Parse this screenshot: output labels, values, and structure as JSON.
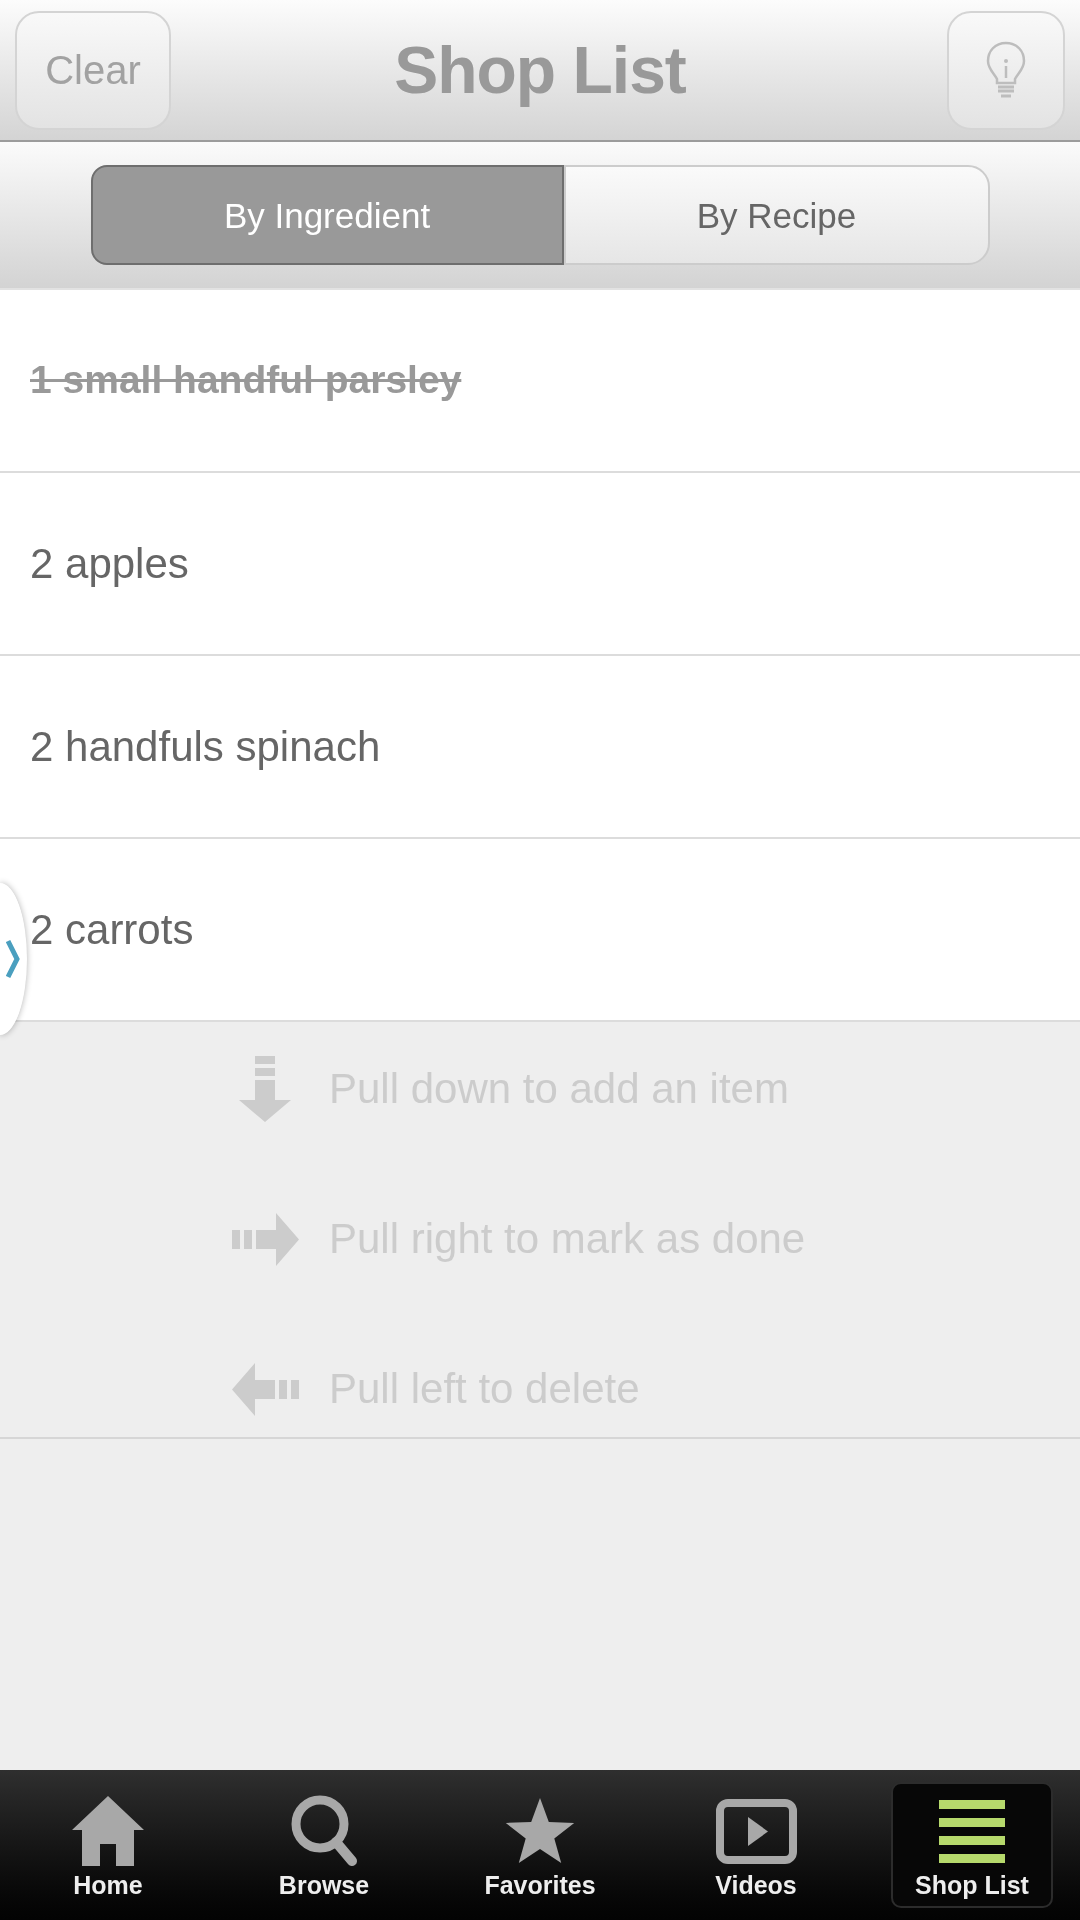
{
  "header": {
    "clear_button": "Clear",
    "title": "Shop List"
  },
  "view_tabs": [
    {
      "label": "By Ingredient",
      "selected": true
    },
    {
      "label": "By Recipe",
      "selected": false
    }
  ],
  "items": [
    {
      "text": "1 small handful parsley",
      "done": true
    },
    {
      "text": "2 apples",
      "done": false
    },
    {
      "text": "2 handfuls spinach",
      "done": false
    },
    {
      "text": "2 carrots",
      "done": false
    }
  ],
  "hints": [
    "Pull down to add an item",
    "Pull right to mark as done",
    "Pull left to delete"
  ],
  "tab_bar": [
    {
      "label": "Home",
      "selected": false
    },
    {
      "label": "Browse",
      "selected": false
    },
    {
      "label": "Favorites",
      "selected": false
    },
    {
      "label": "Videos",
      "selected": false
    },
    {
      "label": "Shop List",
      "selected": true
    }
  ]
}
